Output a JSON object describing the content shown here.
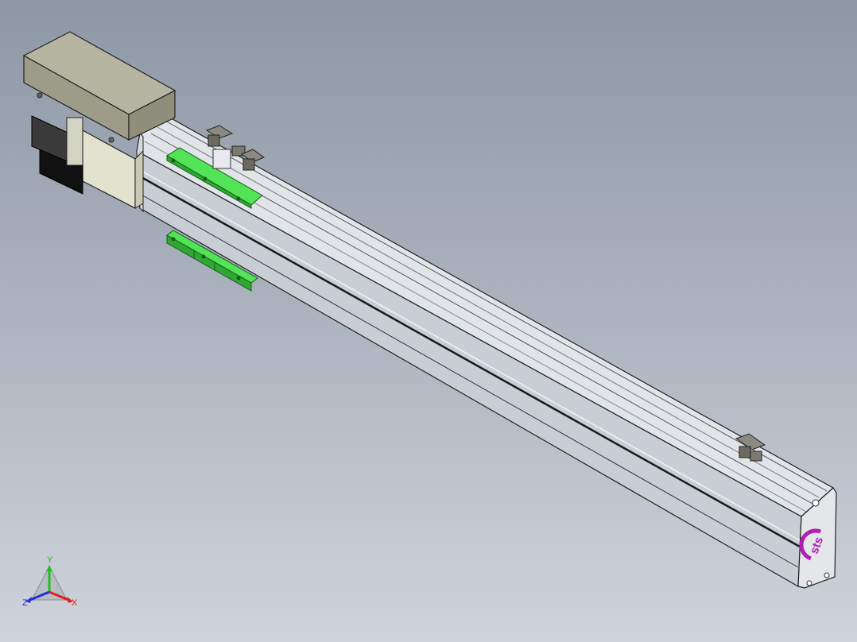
{
  "viewport": {
    "background_top": "#8e98a6",
    "background_bottom": "#cfd4db"
  },
  "model": {
    "end_cap_logo": "sts",
    "colors": {
      "profile_body": "#cdd1d7",
      "profile_top": "#e3e6ea",
      "motor_housing": "#a9a996",
      "coupling_block": "#e2e2cf",
      "motor_body": "#111111",
      "carriage_green": "#46d94a",
      "logo": "#b01fb0"
    }
  },
  "triad": {
    "x_label": "X",
    "y_label": "Y",
    "z_label": "Z",
    "x_color": "#e02020",
    "y_color": "#20c020",
    "z_color": "#2030e0"
  }
}
